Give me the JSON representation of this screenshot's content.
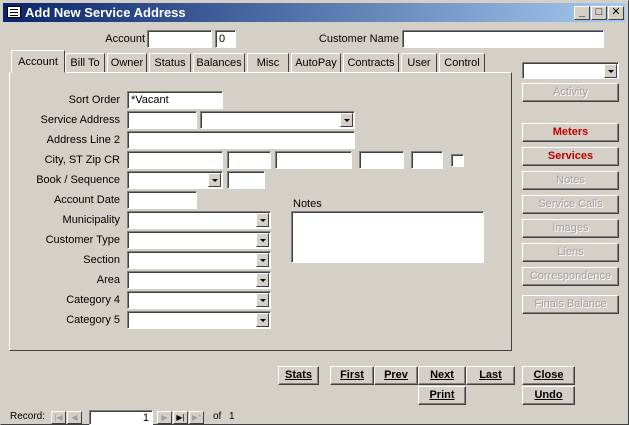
{
  "window": {
    "title": "Add New Service Address"
  },
  "titlebar": {
    "min": "_",
    "max": "□",
    "close": "✕"
  },
  "header": {
    "account_label": "Account",
    "account_value": "",
    "account_suffix": "0",
    "customer_name_label": "Customer Name",
    "customer_name_value": ""
  },
  "tabs": [
    "Account",
    "Bill To",
    "Owner",
    "Status",
    "Balances",
    "Misc",
    "AutoPay",
    "Contracts",
    "User",
    "Control"
  ],
  "form": {
    "sort_order_label": "Sort Order",
    "sort_order_value": "*Vacant",
    "service_address_label": "Service Address",
    "address_line2_label": "Address Line 2",
    "city_state_zip_label": "City, ST Zip  CR",
    "book_sequence_label": "Book / Sequence",
    "account_date_label": "Account Date",
    "municipality_label": "Municipality",
    "customer_type_label": "Customer Type",
    "section_label": "Section",
    "area_label": "Area",
    "category4_label": "Category 4",
    "category5_label": "Category 5",
    "notes_label": "Notes"
  },
  "side_buttons": {
    "activity": "Activity",
    "meters": "Meters",
    "services": "Services",
    "notes": "Notes",
    "service_calls": "Service Calls",
    "images": "Images",
    "liens": "Liens",
    "correspondence": "Correspondence",
    "finals_balance": "Finals Balance"
  },
  "bottom_buttons": {
    "stats": "Stats",
    "first": "First",
    "prev": "Prev",
    "next": "Next",
    "last": "Last",
    "close": "Close",
    "print": "Print",
    "undo": "Undo"
  },
  "record_nav": {
    "label": "Record:",
    "current": "1",
    "of_label": "of",
    "total": "1",
    "first": "|◀",
    "prev": "◀",
    "next": "▶",
    "last": "▶|",
    "new": "▶*"
  }
}
